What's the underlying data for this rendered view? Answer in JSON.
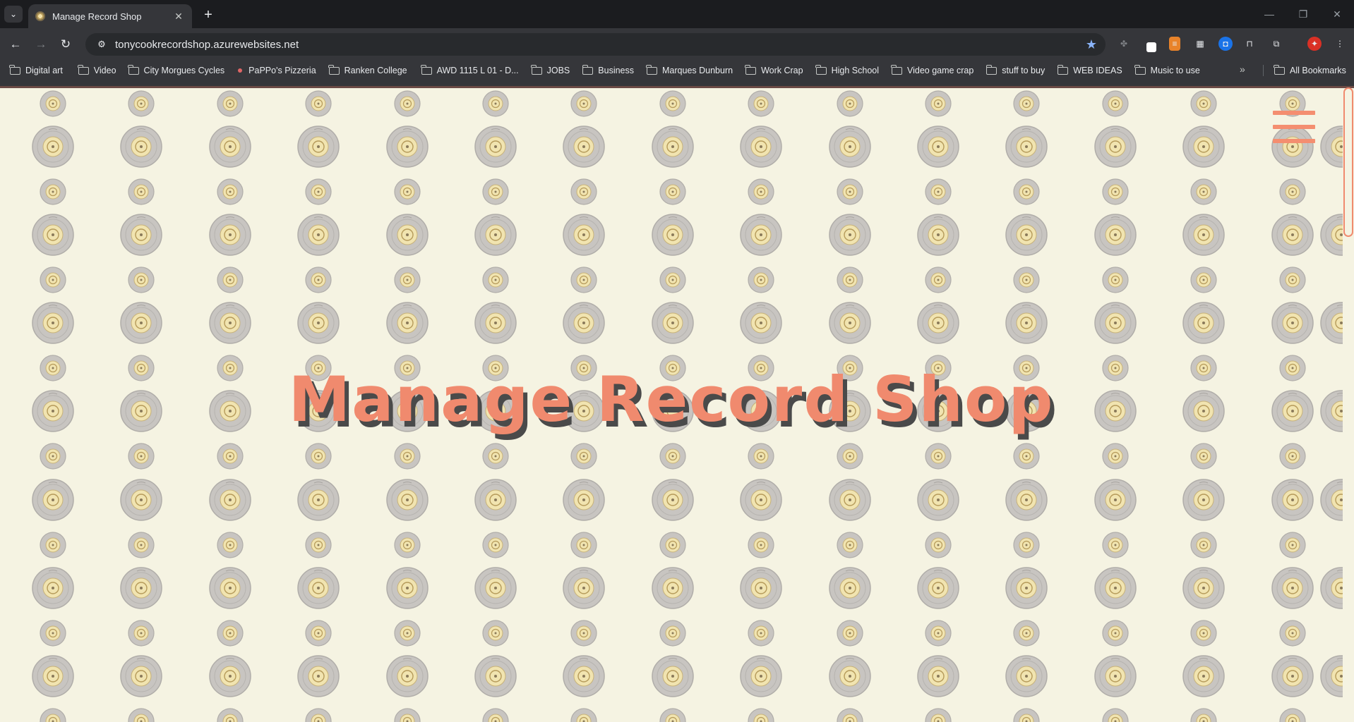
{
  "browser": {
    "tab_title": "Manage Record Shop",
    "url": "tonycookrecordshop.azurewebsites.net",
    "bookmarks": [
      {
        "label": "Digital art",
        "icon": "folder-icon"
      },
      {
        "label": "Video",
        "icon": "folder-icon"
      },
      {
        "label": "City Morgues Cycles",
        "icon": "folder-icon"
      },
      {
        "label": "PaPPo's Pizzeria",
        "icon": "site-favicon"
      },
      {
        "label": "Ranken College",
        "icon": "folder-icon"
      },
      {
        "label": "AWD 1115 L 01 - D...",
        "icon": "folder-icon"
      },
      {
        "label": "JOBS",
        "icon": "folder-icon"
      },
      {
        "label": "Business",
        "icon": "folder-icon"
      },
      {
        "label": "Marques Dunburn",
        "icon": "folder-icon"
      },
      {
        "label": "Work Crap",
        "icon": "folder-icon"
      },
      {
        "label": "High School",
        "icon": "folder-icon"
      },
      {
        "label": "Video game crap",
        "icon": "folder-icon"
      },
      {
        "label": "stuff to buy",
        "icon": "folder-icon"
      },
      {
        "label": "WEB IDEAS",
        "icon": "folder-icon"
      },
      {
        "label": "Music to use",
        "icon": "folder-icon"
      }
    ],
    "all_bookmarks": "All Bookmarks"
  },
  "page": {
    "title": "Manage Record Shop",
    "colors": {
      "background": "#f5f3e2",
      "title": "#f08a6e",
      "title_shadow": "#4a4a4a",
      "record": "#c8c5c1",
      "record_label": "#f1e4b0"
    }
  }
}
